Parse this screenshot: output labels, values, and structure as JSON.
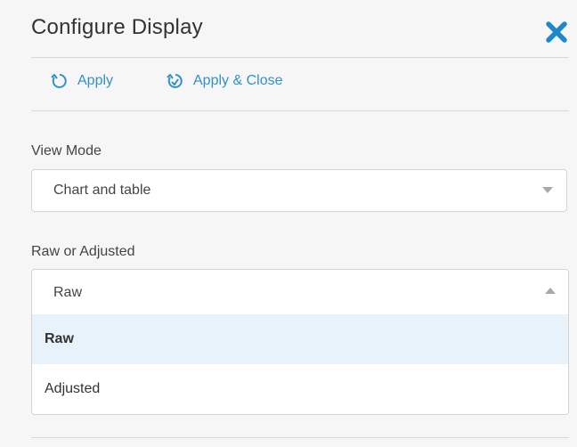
{
  "panel": {
    "title": "Configure Display"
  },
  "actions": {
    "apply_label": "Apply",
    "apply_close_label": "Apply & Close"
  },
  "view_mode": {
    "label": "View Mode",
    "value": "Chart and table"
  },
  "raw_adjusted": {
    "label": "Raw or Adjusted",
    "value": "Raw",
    "options": [
      "Raw",
      "Adjusted"
    ],
    "selected_index": 0
  },
  "colors": {
    "accent": "#3391c5",
    "close": "#1f88c9",
    "selected_bg": "#e7f2fa"
  },
  "icons": {
    "close": "close-icon",
    "apply": "refresh-icon",
    "apply_close": "refresh-check-icon",
    "select_caret": "chevron-down-icon",
    "open_caret": "chevron-up-icon"
  }
}
